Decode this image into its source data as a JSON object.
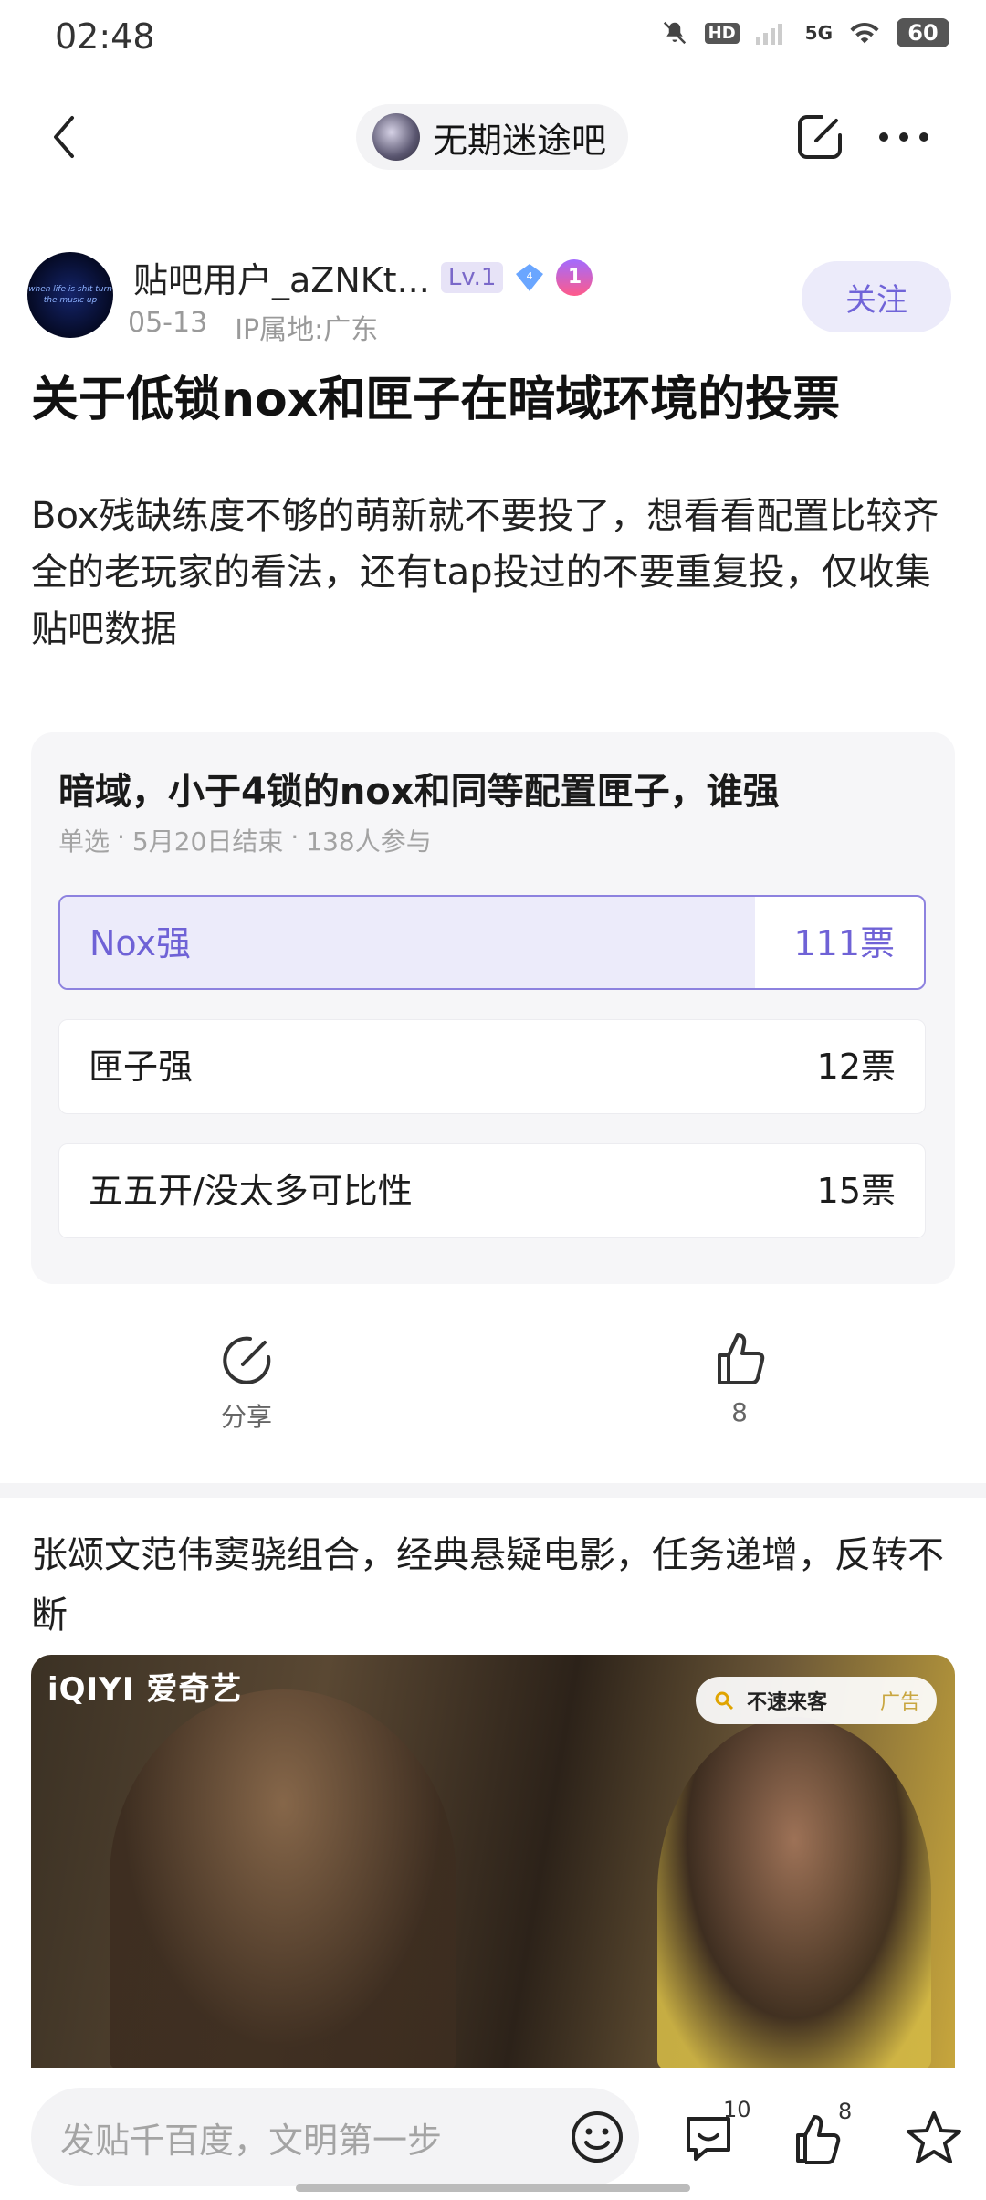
{
  "status_bar": {
    "time": "02:48",
    "network": "5G",
    "battery": "60",
    "icons": [
      "mute-icon",
      "hd-icon",
      "signal-icon",
      "wifi-icon",
      "battery-icon"
    ]
  },
  "nav": {
    "forum_name": "无期迷途吧",
    "icons": [
      "back-arrow-icon",
      "edit-icon",
      "more-icon"
    ]
  },
  "author": {
    "avatar_text": "when life is shit turn the music up",
    "name": "贴吧用户_aZNKt...",
    "level": "Lv.1",
    "medal": "1",
    "date": "05-13",
    "ip": "IP属地:广东",
    "follow_label": "关注"
  },
  "post": {
    "title": "关于低锁nox和匣子在暗域环境的投票",
    "body": "Box残缺练度不够的萌新就不要投了，想看看配置比较齐全的老玩家的看法，还有tap投过的不要重复投，仅收集贴吧数据"
  },
  "poll": {
    "title": "暗域，小于4锁的nox和同等配置匣子，谁强",
    "type": "单选",
    "end": "5月20日结束",
    "participants": "138人参与",
    "separator": "·",
    "options": [
      {
        "label": "Nox强",
        "votes": "111票",
        "vote_count": 111,
        "selected": true
      },
      {
        "label": "匣子强",
        "votes": "12票",
        "vote_count": 12,
        "selected": false
      },
      {
        "label": "五五开/没太多可比性",
        "votes": "15票",
        "vote_count": 15,
        "selected": false
      }
    ]
  },
  "actions": {
    "share_label": "分享",
    "like_count": "8"
  },
  "ad": {
    "text": "张颂文范伟窦骁组合，经典悬疑电影，任务递增，反转不断",
    "brand": "iQIYI 爱奇艺",
    "search_term": "不速来客",
    "ad_tag": "广告"
  },
  "bottom_bar": {
    "input_placeholder": "发贴千百度，文明第一步",
    "comment_count": "10",
    "like_count": "8"
  },
  "colors": {
    "accent": "#6f62d6",
    "accent_light": "#ecebfa",
    "card_bg": "#f6f6f8"
  }
}
